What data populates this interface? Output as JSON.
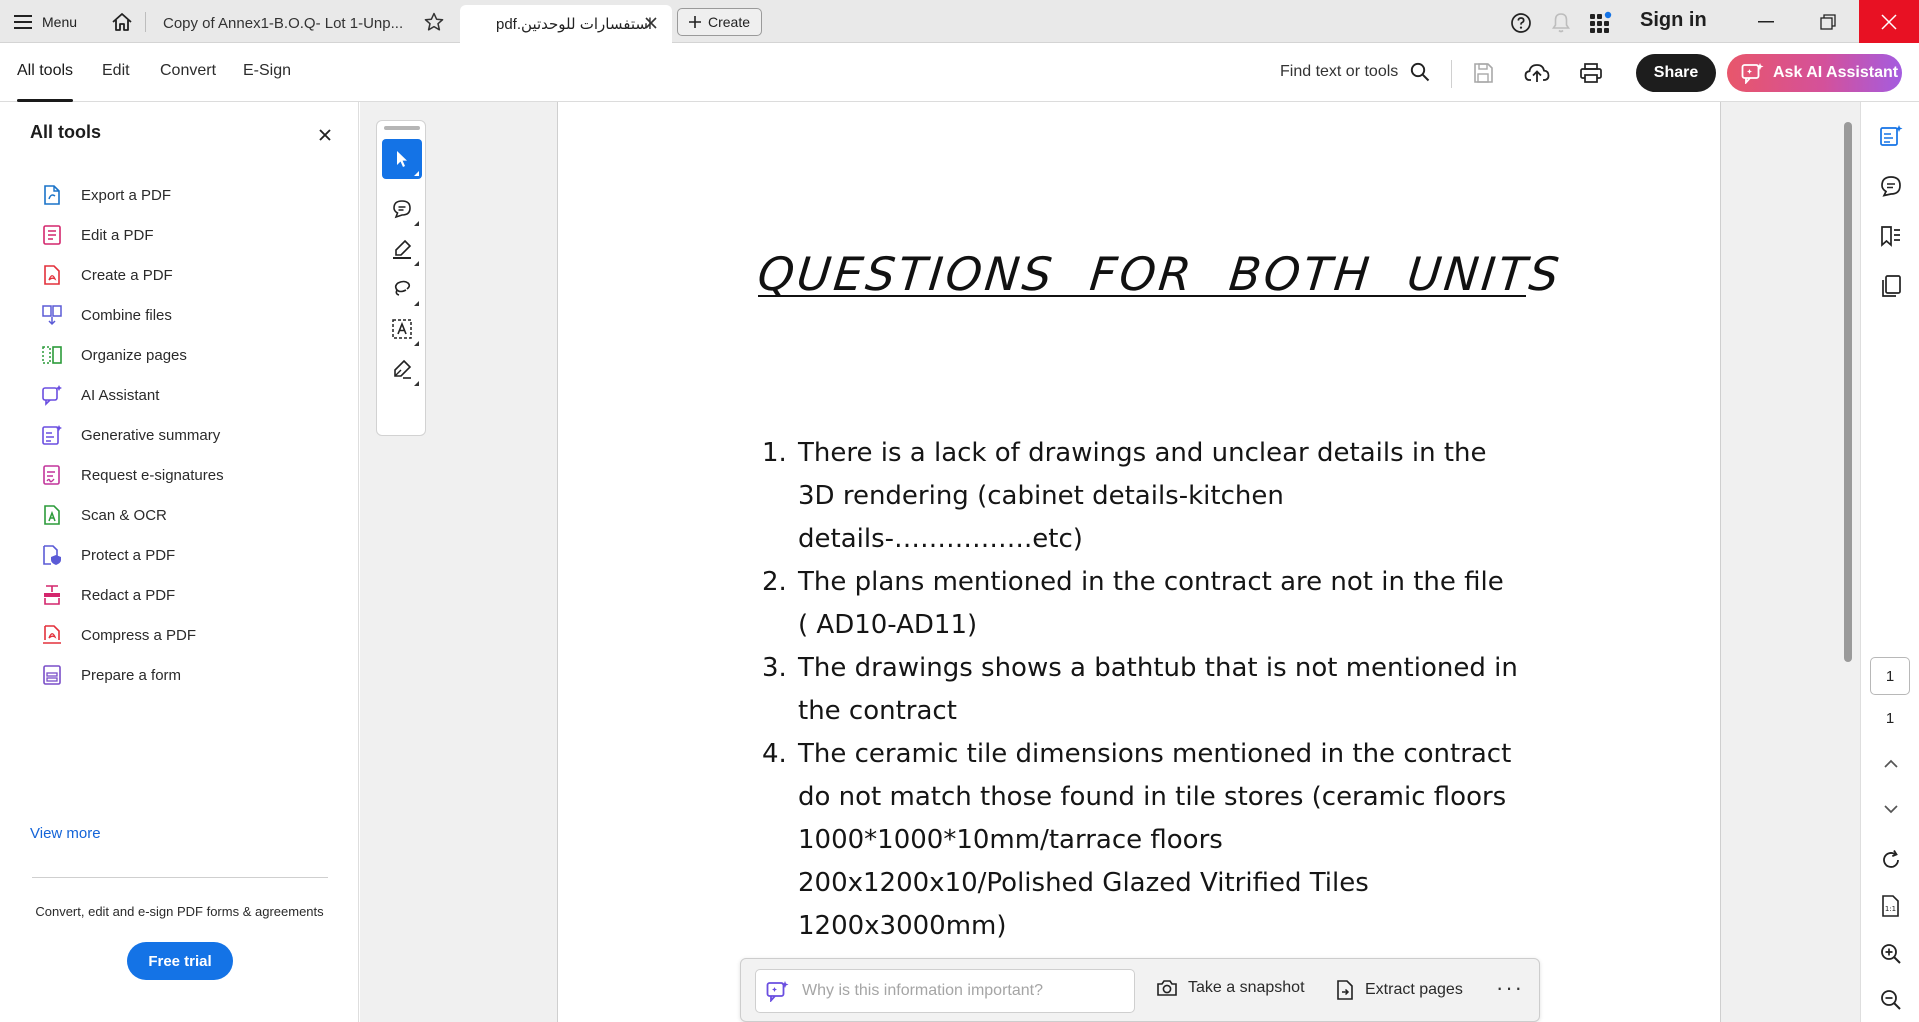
{
  "tabbar": {
    "menu_label": "Menu",
    "tab1_title": "Copy of Annex1-B.O.Q- Lot 1-Unp...",
    "tab2_title": "استفسارات للوحدتين.pdf",
    "create_label": "Create",
    "signin_label": "Sign in"
  },
  "toolbar": {
    "tabs": [
      {
        "label": "All tools",
        "active": true
      },
      {
        "label": "Edit",
        "active": false
      },
      {
        "label": "Convert",
        "active": false
      },
      {
        "label": "E-Sign",
        "active": false
      }
    ],
    "find_label": "Find text or tools",
    "share_label": "Share",
    "ai_label": "Ask AI Assistant"
  },
  "leftpanel": {
    "title": "All tools",
    "items": [
      {
        "label": "Export a PDF",
        "icon": "export-pdf-icon",
        "color": "#1a73c8"
      },
      {
        "label": "Edit a PDF",
        "icon": "edit-pdf-icon",
        "color": "#d4266d"
      },
      {
        "label": "Create a PDF",
        "icon": "create-pdf-icon",
        "color": "#e3303b"
      },
      {
        "label": "Combine files",
        "icon": "combine-files-icon",
        "color": "#5b5bd6"
      },
      {
        "label": "Organize pages",
        "icon": "organize-pages-icon",
        "color": "#2c9b3a"
      },
      {
        "label": "AI Assistant",
        "icon": "ai-assistant-icon",
        "color": "#6a4ee0"
      },
      {
        "label": "Generative summary",
        "icon": "generative-summary-icon",
        "color": "#6a4ee0"
      },
      {
        "label": "Request e-signatures",
        "icon": "request-esignatures-icon",
        "color": "#c2349b"
      },
      {
        "label": "Scan & OCR",
        "icon": "scan-ocr-icon",
        "color": "#2c9b3a"
      },
      {
        "label": "Protect a PDF",
        "icon": "protect-pdf-icon",
        "color": "#5b5bd6"
      },
      {
        "label": "Redact a PDF",
        "icon": "redact-pdf-icon",
        "color": "#d4266d"
      },
      {
        "label": "Compress a PDF",
        "icon": "compress-pdf-icon",
        "color": "#e3303b"
      },
      {
        "label": "Prepare a form",
        "icon": "prepare-form-icon",
        "color": "#7a4ec8"
      }
    ],
    "view_more": "View more",
    "promo_text": "Convert, edit and e-sign PDF forms & agreements",
    "free_trial": "Free trial"
  },
  "document": {
    "title": "QUESTIONS  FOR  BOTH  UNITS",
    "items": [
      {
        "num": "1.",
        "text": "There is a lack of drawings and unclear details in the 3D rendering (cabinet details-kitchen details-…………….etc)"
      },
      {
        "num": "2.",
        "text": "The plans mentioned in the contract are not in the file ( AD10-AD11)"
      },
      {
        "num": "3.",
        "text": "The drawings shows a bathtub that is not mentioned in the contract"
      },
      {
        "num": "4.",
        "text": "The ceramic tile dimensions mentioned in the contract do not match those found in tile stores (ceramic floors 1000*1000*10mm/tarrace floors 200x1200x10/Polished Glazed Vitrified Tiles 1200x3000mm)"
      }
    ]
  },
  "bottombar": {
    "ask_placeholder": "Why is this information important?",
    "snapshot_label": "Take a snapshot",
    "extract_label": "Extract pages",
    "more_label": "···"
  },
  "rightrail": {
    "current_page": "1",
    "total_pages": "1"
  },
  "colors": {
    "accent": "#1473e6",
    "close_red": "#e81123",
    "share_bg": "#1d1d1d"
  }
}
